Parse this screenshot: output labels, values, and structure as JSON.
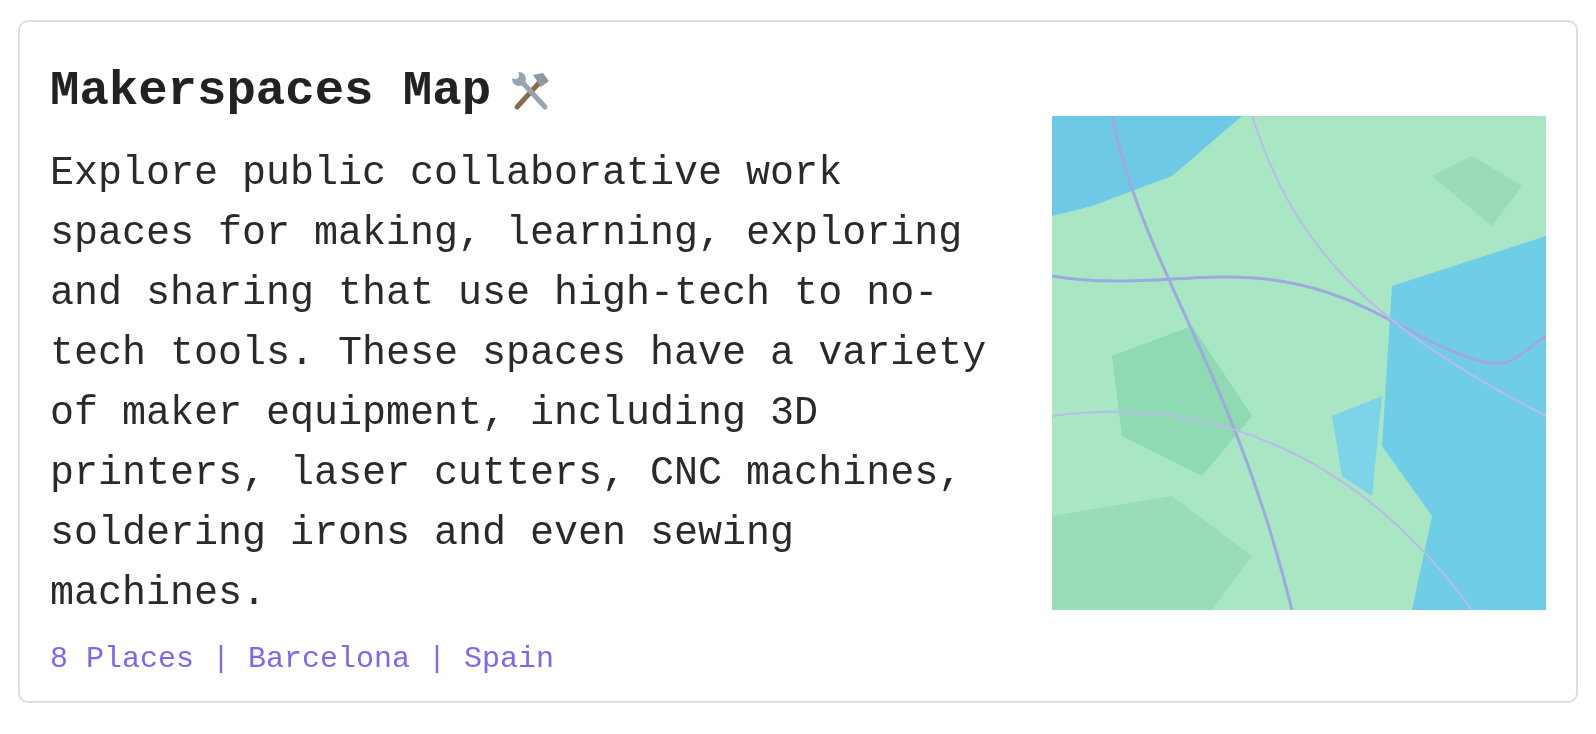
{
  "card": {
    "title": "Makerspaces Map",
    "description": "Explore public collaborative work spaces for making, learning, exploring and sharing that use high-tech to no-tech tools. These spaces have a variety of maker equipment, including 3D printers, laser cutters, CNC machines, soldering irons and even sewing machines.",
    "meta": "8 Places | Barcelona | Spain"
  }
}
